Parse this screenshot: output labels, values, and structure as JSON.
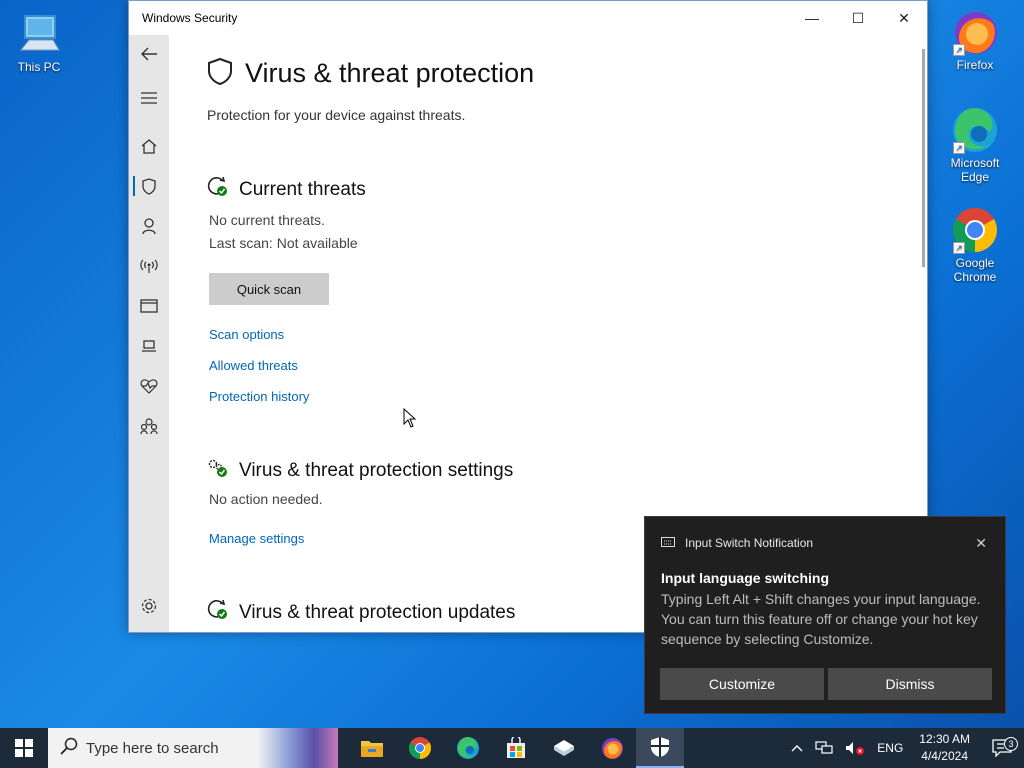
{
  "desktop": {
    "icons": [
      {
        "label": "This PC"
      },
      {
        "label": "Firefox"
      },
      {
        "label": "Microsoft Edge"
      },
      {
        "label": "Google Chrome"
      }
    ]
  },
  "window": {
    "title": "Windows Security",
    "page_title": "Virus & threat protection",
    "page_subtitle": "Protection for your device against threats.",
    "current_threats": {
      "heading": "Current threats",
      "status": "No current threats.",
      "last_scan": "Last scan: Not available",
      "quick_scan_label": "Quick scan",
      "links": [
        "Scan options",
        "Allowed threats",
        "Protection history"
      ]
    },
    "settings": {
      "heading": "Virus & threat protection settings",
      "status": "No action needed.",
      "link": "Manage settings"
    },
    "updates": {
      "heading": "Virus & threat protection updates"
    },
    "nav_icons": [
      "back-icon",
      "menu-icon",
      "home-icon",
      "shield-icon",
      "account-icon",
      "firewall-icon",
      "app-browser-icon",
      "device-security-icon",
      "health-icon",
      "family-icon",
      "settings-icon"
    ]
  },
  "notification": {
    "app": "Input Switch Notification",
    "title": "Input language switching",
    "body": "Typing Left Alt + Shift changes your input language. You can turn this feature off or change your hot key sequence by selecting Customize.",
    "customize_label": "Customize",
    "dismiss_label": "Dismiss"
  },
  "taskbar": {
    "search_placeholder": "Type here to search",
    "language": "ENG",
    "time": "12:30 AM",
    "date": "4/4/2024",
    "notification_count": "3"
  }
}
